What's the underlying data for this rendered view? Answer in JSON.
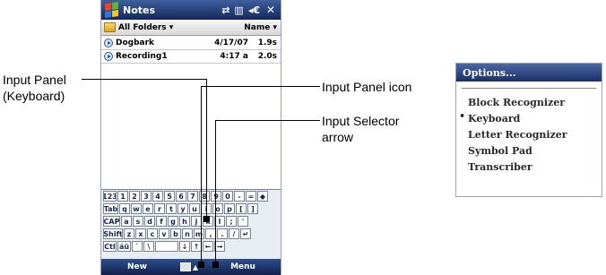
{
  "phone": {
    "title": "Notes",
    "status_icons": [
      "⇄",
      "▥",
      "◂€"
    ],
    "close_label": "✕",
    "folder_label": "All Folders ▾",
    "sort_label": "Name ▾",
    "items": [
      {
        "name": "Dogbark",
        "date": "4/17/07",
        "size": "1.9s"
      },
      {
        "name": "Recording1",
        "date": "4:17 a",
        "size": "2.0s"
      }
    ],
    "keyboard": {
      "rows": [
        [
          "123",
          "1",
          "2",
          "3",
          "4",
          "5",
          "6",
          "7",
          "8",
          "9",
          "0",
          "-",
          "=",
          "◆"
        ],
        [
          "Tab",
          "q",
          "w",
          "e",
          "r",
          "t",
          "y",
          "u",
          "i",
          "o",
          "p",
          "[",
          "]"
        ],
        [
          "CAP",
          "a",
          "s",
          "d",
          "f",
          "g",
          "h",
          "j",
          "k",
          "l",
          ";",
          "'"
        ],
        [
          "Shift",
          "z",
          "x",
          "c",
          "v",
          "b",
          "n",
          "m",
          ",",
          ".",
          "/",
          "↵"
        ],
        [
          "Ctl",
          "áü",
          "`",
          "\\",
          "",
          "↓",
          "↑",
          "←",
          "→"
        ]
      ]
    },
    "menu_left": "New",
    "menu_right": "Menu",
    "sip_arrow": "▲"
  },
  "callouts": {
    "input_panel": "Input Panel\n(Keyboard)",
    "input_panel_icon": "Input Panel icon",
    "input_selector_arrow": "Input Selector\narrow"
  },
  "options_menu": {
    "header": "Options...",
    "items": [
      "Block Recognizer",
      "Keyboard",
      "Letter Recognizer",
      "Symbol Pad",
      "Transcriber"
    ],
    "selected_bullet": "•"
  },
  "colors": {
    "titlebar": "#1d3570",
    "keyboard_bg": "#e8ecf3",
    "key_text": "#16245a"
  }
}
